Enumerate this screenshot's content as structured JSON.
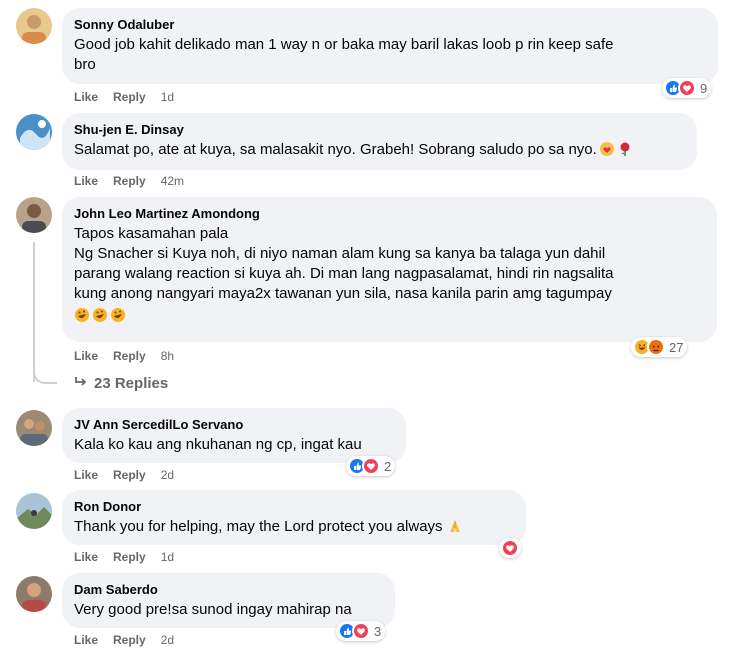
{
  "comments": [
    {
      "author": "Sonny Odaluber",
      "lines": [
        "Good job kahit delikado man 1 way n or baka may baril lakas loob p rin keep safe",
        "bro"
      ],
      "like": "Like",
      "reply": "Reply",
      "time": "1d",
      "reaction_count": "9",
      "reactions": [
        "like",
        "love"
      ]
    },
    {
      "author": "Shu-jen E. Dinsay",
      "lines": [
        "Salamat po, ate at kuya, sa malasakit nyo. Grabeh! Sobrang saludo po sa nyo."
      ],
      "like": "Like",
      "reply": "Reply",
      "time": "42m",
      "emojis": [
        "heart-hands",
        "rose"
      ]
    },
    {
      "author": "John Leo Martinez Amondong",
      "lines": [
        "Tapos kasamahan pala",
        "Ng Snacher si Kuya noh, di niyo naman alam kung sa kanya ba talaga yun dahil",
        "parang walang reaction si kuya ah. Di man lang nagpasalamat, hindi rin nagsalita",
        "kung anong nangyari maya2x tawanan yun sila, nasa kanila parin amg tagumpay"
      ],
      "like": "Like",
      "reply": "Reply",
      "time": "8h",
      "reaction_count": "27",
      "reactions": [
        "haha",
        "angry"
      ]
    },
    {
      "author": "JV Ann SercedilLo Servano",
      "lines": [
        "Kala ko kau ang nkuhanan ng cp, ingat kau"
      ],
      "like": "Like",
      "reply": "Reply",
      "time": "2d",
      "reaction_count": "2",
      "reactions": [
        "like",
        "love"
      ]
    },
    {
      "author": "Ron Donor",
      "lines": [
        "Thank you for helping, may the Lord protect you always"
      ],
      "like": "Like",
      "reply": "Reply",
      "time": "1d",
      "reactions": [
        "love"
      ]
    },
    {
      "author": "Dam Saberdo",
      "lines": [
        "Very good pre!sa sunod ingay mahirap na"
      ],
      "like": "Like",
      "reply": "Reply",
      "time": "2d",
      "reaction_count": "3",
      "reactions": [
        "like",
        "love"
      ]
    }
  ],
  "thread": {
    "replies_label": "23 Replies"
  },
  "colors": {
    "bubble": "#f0f2f5",
    "muted": "#65676b",
    "like": "#1877f2",
    "love": "#f33e58",
    "haha": "#f7b125",
    "angry": "#e9710f"
  }
}
